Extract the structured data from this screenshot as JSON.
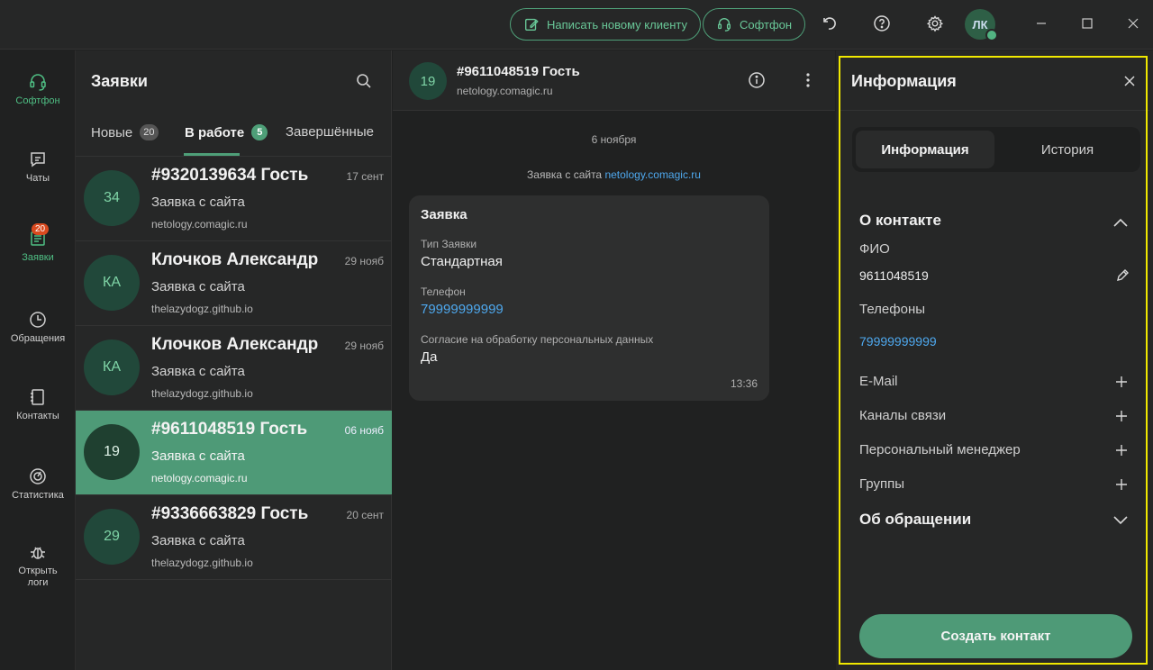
{
  "topbar": {
    "write_new_client": "Написать новому клиенту",
    "softphone": "Софтфон",
    "user_initials": "ЛК",
    "accent": "#4e9f78"
  },
  "leftnav": {
    "items": [
      {
        "label": "Софтфон",
        "icon": "headset-icon"
      },
      {
        "label": "Чаты",
        "icon": "chat-icon"
      },
      {
        "label": "Заявки",
        "icon": "requests-icon",
        "badge": "20"
      },
      {
        "label": "Обращения",
        "icon": "clock-icon"
      },
      {
        "label": "Контакты",
        "icon": "contacts-icon"
      },
      {
        "label": "Статистика",
        "icon": "stats-icon"
      },
      {
        "label": "Открыть логи",
        "icon": "bug-icon"
      }
    ]
  },
  "list": {
    "title": "Заявки",
    "tabs": [
      {
        "label": "Новые",
        "count": "20"
      },
      {
        "label": "В работе",
        "count": "5"
      },
      {
        "label": "Завершённые",
        "count": ""
      }
    ],
    "items": [
      {
        "initials": "34",
        "name": "#9320139634 Гость",
        "date": "17 сент",
        "subtitle": "Заявка с сайта",
        "site": "netology.comagic.ru"
      },
      {
        "initials": "КА",
        "name": "Клочков Александр",
        "date": "29 нояб",
        "subtitle": "Заявка с сайта",
        "site": "thelazydogz.github.io"
      },
      {
        "initials": "КА",
        "name": "Клочков Александр",
        "date": "29 нояб",
        "subtitle": "Заявка с сайта",
        "site": "thelazydogz.github.io"
      },
      {
        "initials": "19",
        "name": "#9611048519 Гость",
        "date": "06 нояб",
        "subtitle": "Заявка с сайта",
        "site": "netology.comagic.ru"
      },
      {
        "initials": "29",
        "name": "#9336663829 Гость",
        "date": "20 сент",
        "subtitle": "Заявка с сайта",
        "site": "thelazydogz.github.io"
      }
    ]
  },
  "chat": {
    "avatar": "19",
    "title": "#9611048519 Гость",
    "subtitle": "netology.comagic.ru",
    "date_separator": "6 ноября",
    "system_prefix": "Заявка с сайта ",
    "system_link": "netology.comagic.ru",
    "card": {
      "heading": "Заявка",
      "type_label": "Тип Заявки",
      "type_value": "Стандартная",
      "phone_label": "Телефон",
      "phone_value": "79999999999",
      "consent_label": "Согласие на обработку персональных данных",
      "consent_value": "Да",
      "time": "13:36"
    }
  },
  "info": {
    "title": "Информация",
    "tabs": [
      "Информация",
      "История"
    ],
    "contact_section": "О контакте",
    "fio_label": "ФИО",
    "fio_value": "9611048519",
    "phones_label": "Телефоны",
    "phones_value": "79999999999",
    "email_label": "E-Mail",
    "channels_label": "Каналы связи",
    "manager_label": "Персональный менеджер",
    "groups_label": "Группы",
    "appeal_section": "Об обращении",
    "create_button": "Создать контакт"
  }
}
